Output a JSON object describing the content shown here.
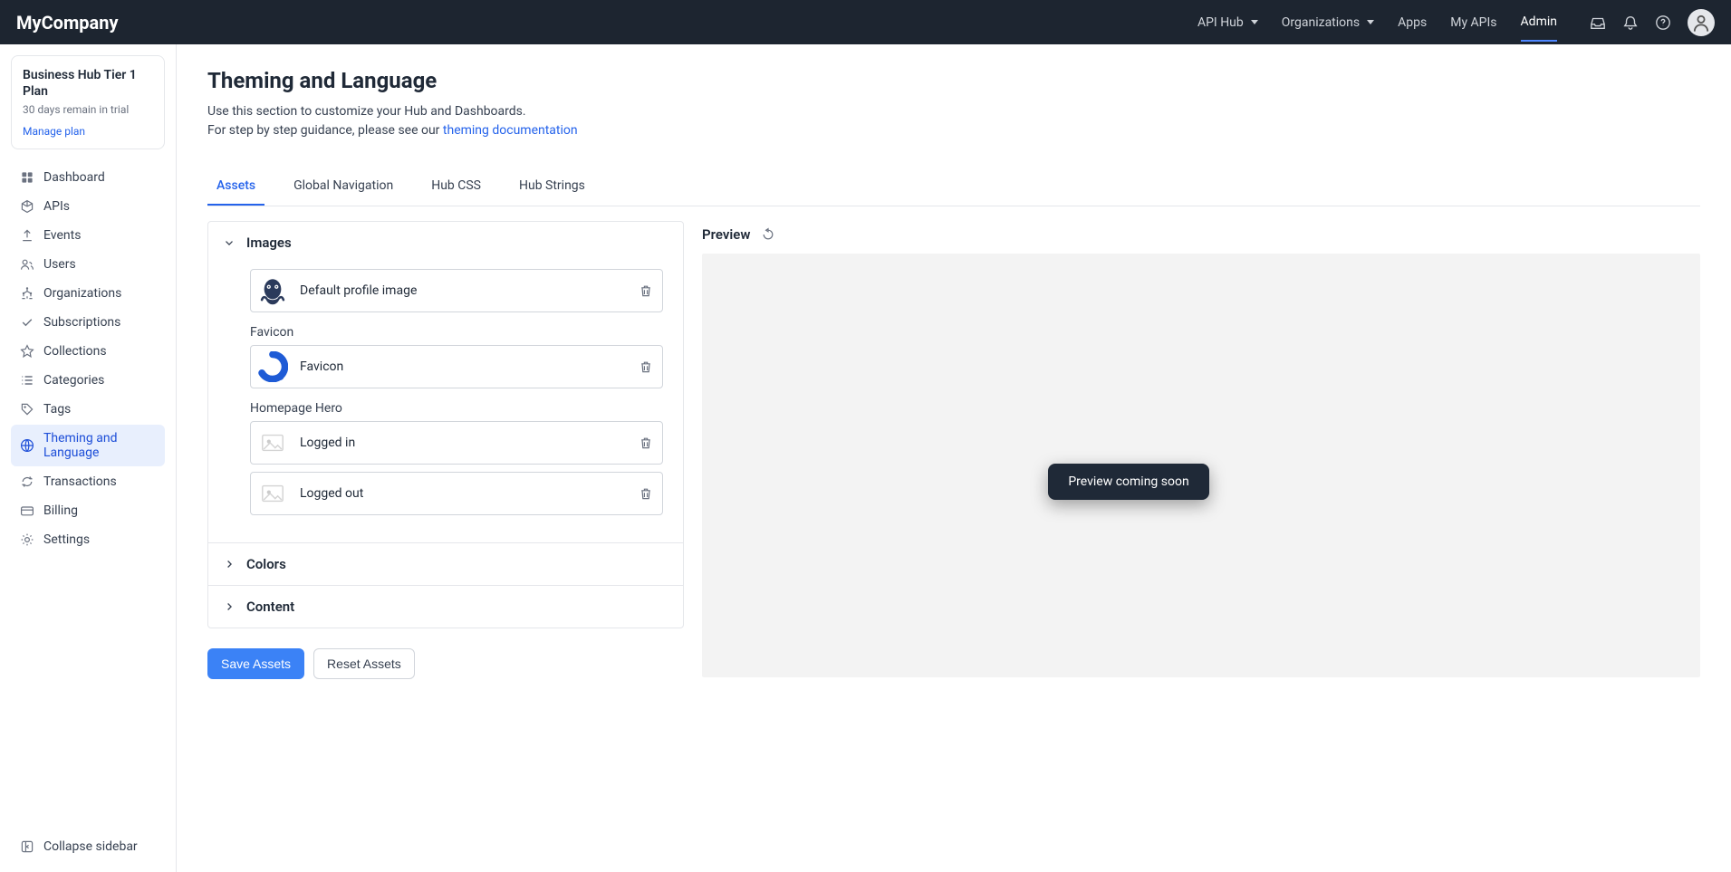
{
  "brand": "MyCompany",
  "topnav": [
    {
      "label": "API Hub",
      "dropdown": true
    },
    {
      "label": "Organizations",
      "dropdown": true
    },
    {
      "label": "Apps"
    },
    {
      "label": "My APIs"
    },
    {
      "label": "Admin",
      "active": true
    }
  ],
  "plan": {
    "title": "Business Hub Tier 1 Plan",
    "subtitle": "30 days remain in trial",
    "manage": "Manage plan"
  },
  "sidebar": [
    {
      "label": "Dashboard",
      "icon": "dashboard"
    },
    {
      "label": "APIs",
      "icon": "cube"
    },
    {
      "label": "Events",
      "icon": "upload"
    },
    {
      "label": "Users",
      "icon": "users"
    },
    {
      "label": "Organizations",
      "icon": "org"
    },
    {
      "label": "Subscriptions",
      "icon": "check"
    },
    {
      "label": "Collections",
      "icon": "star"
    },
    {
      "label": "Categories",
      "icon": "list"
    },
    {
      "label": "Tags",
      "icon": "tag"
    },
    {
      "label": "Theming and Language",
      "icon": "globe",
      "active": true
    },
    {
      "label": "Transactions",
      "icon": "refresh"
    },
    {
      "label": "Billing",
      "icon": "card"
    },
    {
      "label": "Settings",
      "icon": "gear"
    }
  ],
  "collapse": "Collapse sidebar",
  "page": {
    "title": "Theming and Language",
    "desc1": "Use this section to customize your Hub and Dashboards.",
    "desc2_prefix": "For step by step guidance, please see our ",
    "desc2_link": "theming documentation"
  },
  "tabs": [
    "Assets",
    "Global Navigation",
    "Hub CSS",
    "Hub Strings"
  ],
  "active_tab": 0,
  "accordions": {
    "images": {
      "title": "Images",
      "open": true
    },
    "colors": {
      "title": "Colors",
      "open": false
    },
    "content": {
      "title": "Content",
      "open": false
    }
  },
  "assets": {
    "default_profile": {
      "label": "Default profile image"
    },
    "favicon_section": "Favicon",
    "favicon": {
      "label": "Favicon"
    },
    "hero_section": "Homepage Hero",
    "hero_logged_in": {
      "label": "Logged in"
    },
    "hero_logged_out": {
      "label": "Logged out"
    }
  },
  "buttons": {
    "save": "Save Assets",
    "reset": "Reset Assets"
  },
  "preview": {
    "title": "Preview",
    "tooltip": "Preview coming soon"
  }
}
